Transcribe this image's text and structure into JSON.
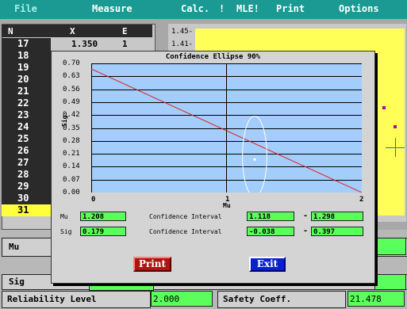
{
  "menu": {
    "file": "File",
    "measure": "Measure",
    "calc": "Calc.",
    "bang": "!",
    "mle": "MLE!",
    "print": "Print",
    "options": "Options"
  },
  "table": {
    "headers": [
      "N",
      "X",
      "E"
    ],
    "row17_x": "1.350",
    "row17_e": "1",
    "rows": [
      "17",
      "18",
      "19",
      "20",
      "21",
      "22",
      "23",
      "24",
      "25",
      "26",
      "27",
      "28",
      "29",
      "30",
      "31"
    ]
  },
  "right_plot": {
    "labels": [
      "1.45-",
      "1.41-"
    ]
  },
  "bottom": {
    "mu_label": "Mu",
    "sig_label": "Sig",
    "reliability_label": "Reliability Level",
    "reliability_value": "2.000",
    "safety_label": "Safety Coeff.",
    "safety_value": "21.478"
  },
  "dialog": {
    "title": "Confidence Ellipse 90%",
    "ylabel": "Sig",
    "xlabel": "Mu",
    "yticks": [
      "0.70",
      "0.63",
      "0.56",
      "0.49",
      "0.42",
      "0.35",
      "0.28",
      "0.21",
      "0.14",
      "0.07",
      "0.00"
    ],
    "xticks": [
      "0",
      "1",
      "2"
    ],
    "mu_label": "Mu",
    "mu_value": "1.208",
    "sig_label": "Sig",
    "sig_value": "0.179",
    "ci_label": "Confidence Interval",
    "mu_ci_low": "1.118",
    "mu_ci_high": "1.298",
    "sig_ci_low": "-0.038",
    "sig_ci_high": "0.397",
    "dash": "-",
    "print_button": "Print",
    "exit_button": "Exit"
  },
  "chart_data": {
    "type": "scatter",
    "title": "Confidence Ellipse 90%",
    "xlabel": "Mu",
    "ylabel": "Sig",
    "xlim": [
      0,
      2
    ],
    "ylim": [
      0,
      0.7
    ],
    "point": {
      "x": 1.208,
      "y": 0.179
    },
    "line": [
      {
        "x": 0,
        "y": 0.67
      },
      {
        "x": 2,
        "y": 0.0
      }
    ],
    "ellipse": {
      "cx": 1.208,
      "cy": 0.179,
      "rx": 0.09,
      "ry": 0.218
    },
    "colors": {
      "line": "#e02020",
      "ellipse": "#ffffff",
      "plot_bg": "#a3cdfb"
    }
  }
}
